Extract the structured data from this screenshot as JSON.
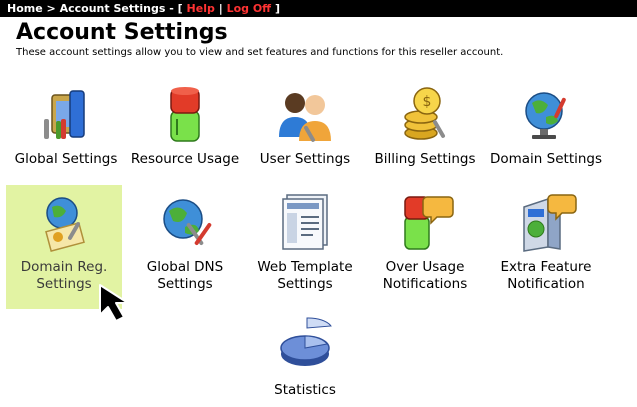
{
  "breadcrumb": {
    "home": "Home",
    "sep": ">",
    "current": "Account Settings",
    "dash": "-",
    "open": "[",
    "help": "Help",
    "pipe": "|",
    "logoff": "Log Off",
    "close": "]"
  },
  "header": {
    "title": "Account Settings",
    "description": "These account settings allow you to view and set features and functions for this reseller account."
  },
  "tiles": [
    {
      "line1": "Global Settings",
      "line2": ""
    },
    {
      "line1": "Resource Usage",
      "line2": ""
    },
    {
      "line1": "User Settings",
      "line2": ""
    },
    {
      "line1": "Billing Settings",
      "line2": ""
    },
    {
      "line1": "Domain Settings",
      "line2": ""
    },
    {
      "line1": "Domain Reg.",
      "line2": "Settings"
    },
    {
      "line1": "Global DNS",
      "line2": "Settings"
    },
    {
      "line1": "Web Template",
      "line2": "Settings"
    },
    {
      "line1": "Over Usage",
      "line2": "Notifications"
    },
    {
      "line1": "Extra Feature",
      "line2": "Notification"
    },
    {
      "line1": "Statistics",
      "line2": ""
    }
  ],
  "colors": {
    "topbar_bg": "#000000",
    "link_red": "#ff3333",
    "highlight_bg": "#e2f3a3"
  }
}
